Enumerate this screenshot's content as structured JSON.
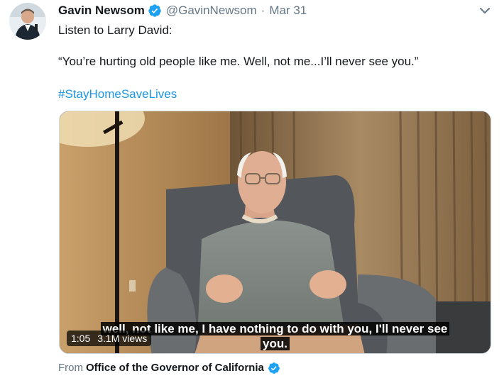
{
  "tweet": {
    "author_name": "Gavin Newsom",
    "handle": "@GavinNewsom",
    "separator": "·",
    "date": "Mar 31",
    "lines": [
      "Listen to Larry David:",
      "“You’re hurting old people like me. Well, not me...I’ll never see you.”"
    ],
    "hashtag": "#StayHomeSaveLives"
  },
  "video": {
    "subtitle_line1": "well, not like me, I have nothing to do with you, I'll never see",
    "subtitle_line2": "you.",
    "duration": "1:05",
    "views": "3.1M views"
  },
  "source": {
    "from_label": "From",
    "org_name": "Office of the Governor of California"
  },
  "icons": {
    "verified": "verified-badge-icon",
    "caret": "chevron-down-icon"
  },
  "colors": {
    "link": "#1b95e0",
    "verified": "#1da1f2",
    "muted": "#657786"
  }
}
